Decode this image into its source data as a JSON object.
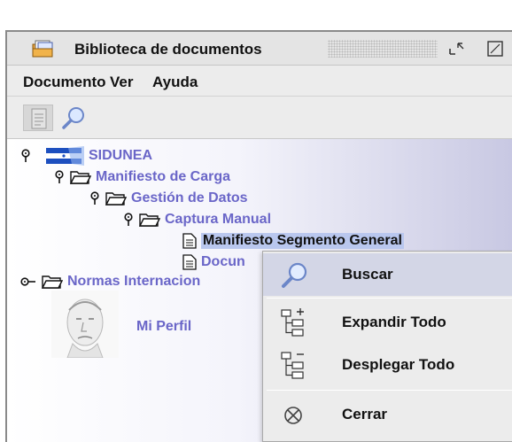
{
  "window": {
    "title": "Biblioteca de documentos"
  },
  "menubar": {
    "items": [
      {
        "label": "Documento"
      },
      {
        "label": "Ver"
      },
      {
        "label": "Ayuda"
      }
    ]
  },
  "toolbar": {
    "buttons": [
      {
        "icon": "document-list-icon"
      },
      {
        "icon": "search-icon"
      }
    ]
  },
  "tree": {
    "nodes": [
      {
        "label": "SIDUNEA",
        "icon": "flag-icon",
        "expanded": true
      },
      {
        "label": "Manifiesto de Carga",
        "icon": "folder-icon",
        "expanded": true
      },
      {
        "label": "Gestión de Datos",
        "icon": "folder-icon",
        "expanded": true
      },
      {
        "label": "Captura Manual",
        "icon": "folder-icon",
        "expanded": true
      },
      {
        "label": "Manifiesto Segmento General",
        "icon": "document-icon",
        "selected": true
      },
      {
        "label": "Docun",
        "icon": "document-icon"
      },
      {
        "label": "Normas Internacion",
        "icon": "folder-icon",
        "expanded": false
      }
    ],
    "profile": {
      "label": "Mi Perfil"
    }
  },
  "context_menu": {
    "items": [
      {
        "label": "Buscar",
        "icon": "search-icon"
      },
      {
        "label": "Expandir Todo",
        "icon": "expand-tree-icon"
      },
      {
        "label": "Desplegar Todo",
        "icon": "collapse-tree-icon"
      },
      {
        "label": "Cerrar",
        "icon": "close-circle-icon"
      }
    ]
  },
  "colors": {
    "link_text": "#6a66c8",
    "tree_gradient_end": "#c7c7e2",
    "menu_hover": "#d3d6e6"
  }
}
